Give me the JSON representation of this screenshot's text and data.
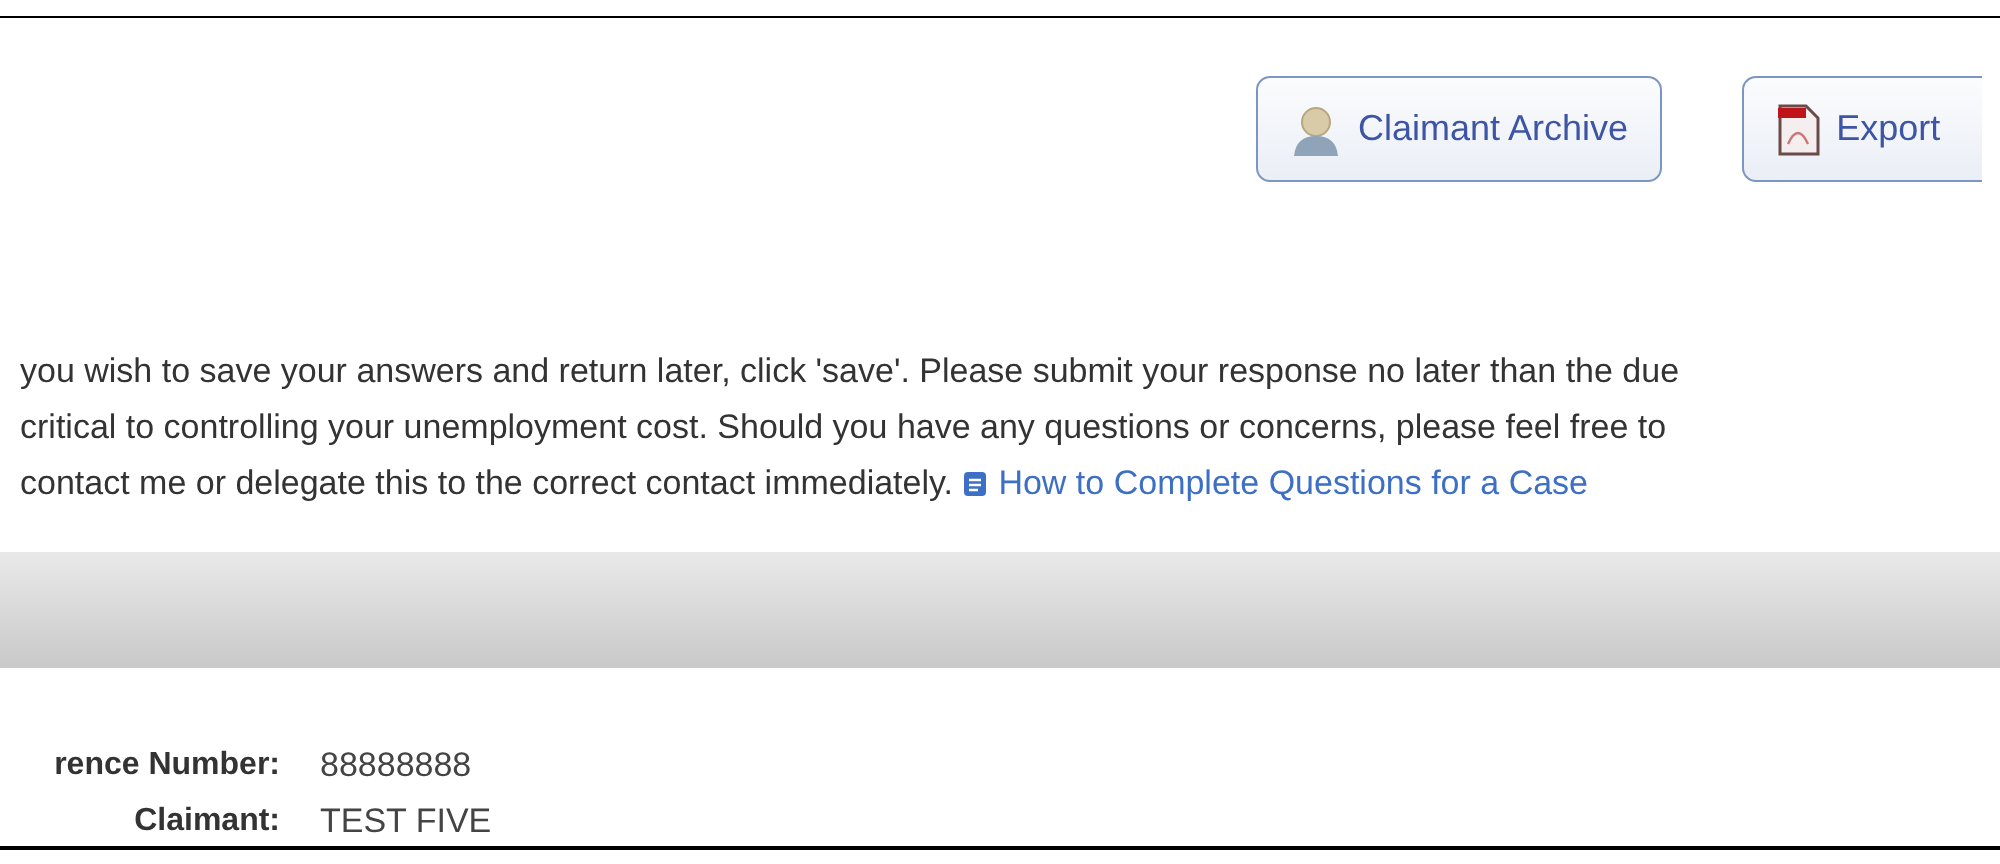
{
  "buttons": [
    {
      "label": "Claimant Archive",
      "kind": "person"
    },
    {
      "label": "Export",
      "kind": "pdf"
    }
  ],
  "instructions": {
    "lines": [
      "you wish to save your answers and return later, click 'save'. Please submit your response no later than the due",
      "critical to controlling your unemployment cost. Should you have any questions or concerns, please feel free to",
      "contact me or delegate this to the correct contact immediately."
    ],
    "link": "How to Complete Questions for a Case"
  },
  "details": [
    {
      "label": "rence Number:",
      "value": "88888888"
    },
    {
      "label": "Claimant:",
      "value": "TEST FIVE"
    }
  ]
}
